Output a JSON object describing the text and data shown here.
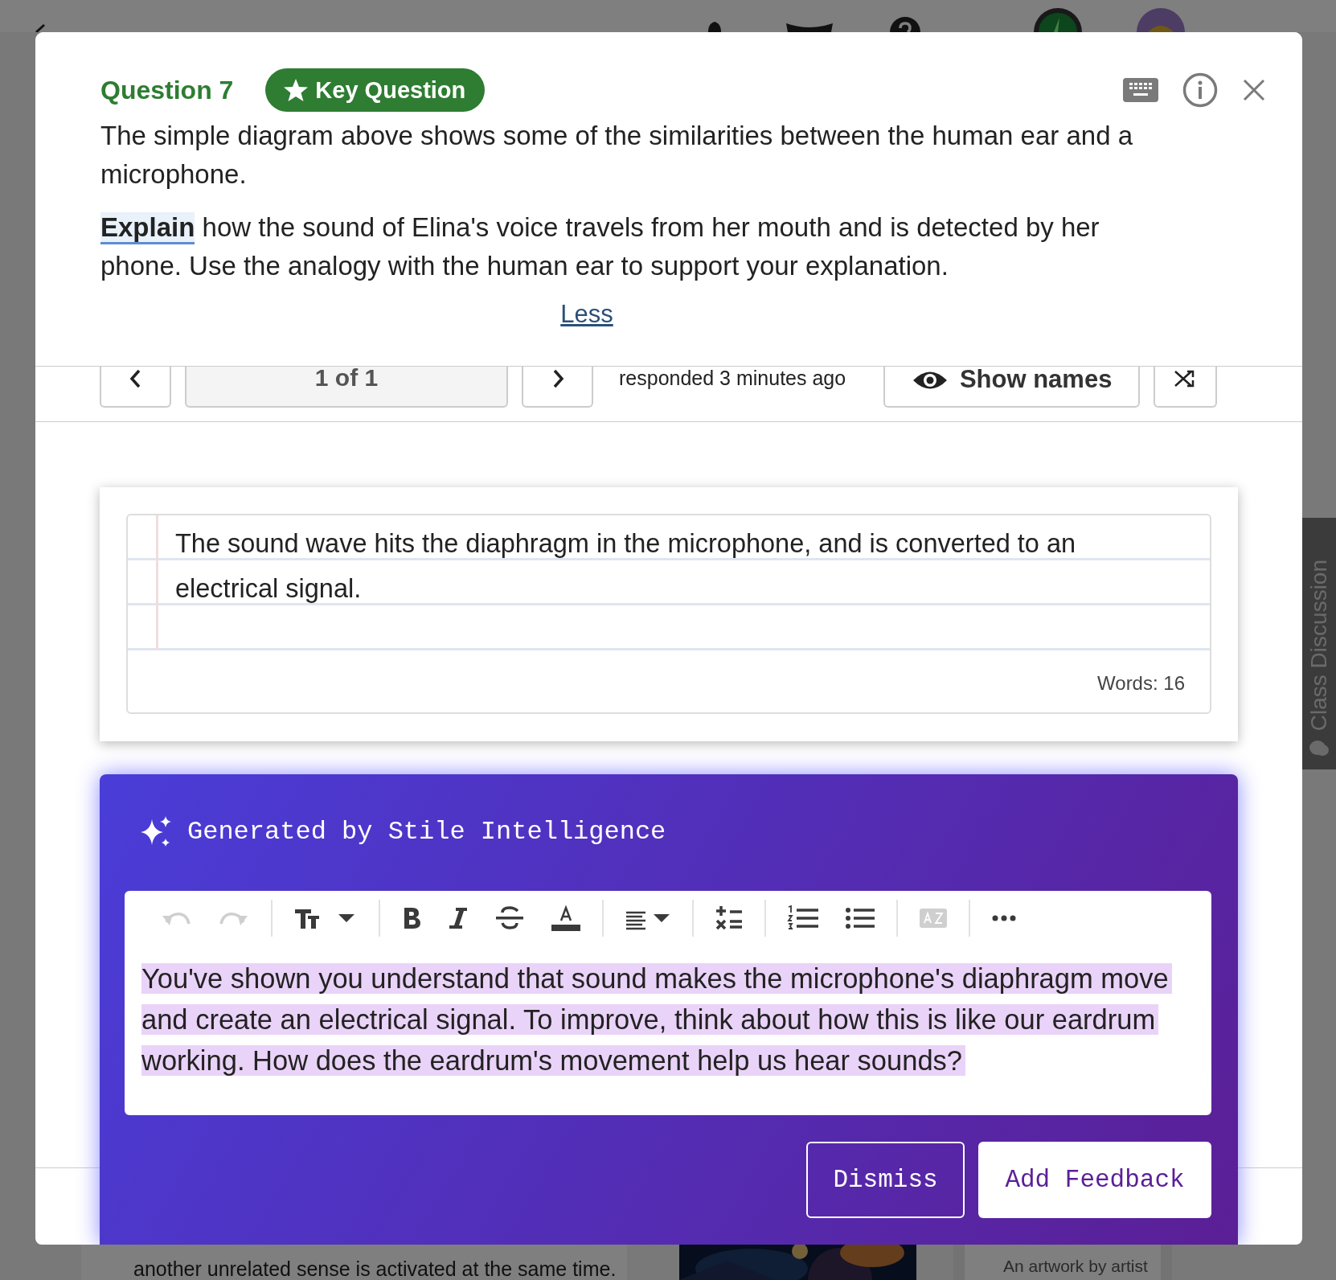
{
  "background": {
    "side_tab": "Class Discussion",
    "cards": [
      {
        "kind": "text",
        "lines": [
          "another unrelated sense is activated at the same time."
        ]
      },
      {
        "kind": "picture"
      },
      {
        "kind": "caption",
        "lines": [
          "An artwork by artist"
        ]
      }
    ]
  },
  "question": {
    "title": "Question 7",
    "badge": "Key Question",
    "prompt": "The simple diagram above shows some of the similarities between the human ear and a microphone.",
    "instruction": "**Explain** how the sound of Elina's voice travels from her mouth and is detected by her phone. Use the analogy with the human ear to support your explanation.",
    "toggle_link": "Less"
  },
  "navigation": {
    "counter": "1 of 1",
    "status": "responded 3 minutes ago",
    "show_names": "Show names"
  },
  "response": {
    "text": "The sound wave hits the diaphragm in the microphone, and is converted to an electrical signal.",
    "word_count": "Words: 16"
  },
  "ai_panel": {
    "title": "Generated by Stile Intelligence",
    "toolbar": [
      {
        "kind": "undo",
        "disabled": true
      },
      {
        "kind": "redo",
        "disabled": true
      },
      {
        "kind": "separator"
      },
      {
        "kind": "text-size",
        "disabled": false
      },
      {
        "kind": "separator"
      },
      {
        "kind": "bold",
        "disabled": false
      },
      {
        "kind": "italic",
        "disabled": false
      },
      {
        "kind": "strikethrough",
        "disabled": false
      },
      {
        "kind": "font-color",
        "disabled": false
      },
      {
        "kind": "separator"
      },
      {
        "kind": "align",
        "disabled": false
      },
      {
        "kind": "separator"
      },
      {
        "kind": "formula",
        "disabled": false
      },
      {
        "kind": "separator"
      },
      {
        "kind": "ordered-list",
        "disabled": false
      },
      {
        "kind": "bullet-list",
        "disabled": false
      },
      {
        "kind": "separator"
      },
      {
        "kind": "dictionary",
        "disabled": true
      },
      {
        "kind": "separator"
      },
      {
        "kind": "more",
        "disabled": false
      }
    ],
    "feedback": "You've shown you understand that sound makes the microphone's diaphragm move and create an electrical signal. To improve, think about how this is like our eardrum working. How does the eardrum's movement help us hear sounds?",
    "buttons": [
      {
        "label": "Dismiss",
        "kind": "secondary"
      },
      {
        "label": "Add Feedback",
        "kind": "primary"
      }
    ]
  }
}
